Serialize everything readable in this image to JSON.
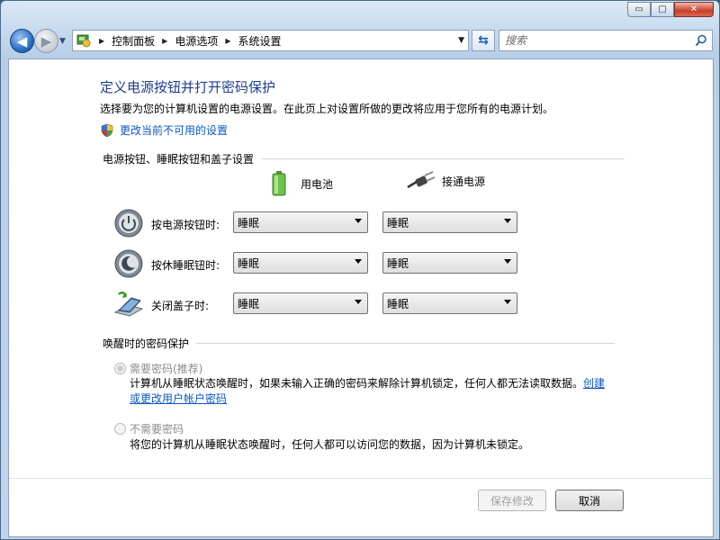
{
  "window": {
    "buttons": {
      "minimize": "▭",
      "maximize": "□",
      "close": "✕"
    }
  },
  "nav": {
    "breadcrumbs": [
      "控制面板",
      "电源选项",
      "系统设置"
    ],
    "search_placeholder": "搜索"
  },
  "page": {
    "title": "定义电源按钮并打开密码保护",
    "description": "选择要为您的计算机设置的电源设置。在此页上对设置所做的更改将应用于您所有的电源计划。",
    "change_link": "更改当前不可用的设置"
  },
  "buttons_section": {
    "heading": "电源按钮、睡眠按钮和盖子设置",
    "col_battery": "用电池",
    "col_plugged": "接通电源",
    "rows": [
      {
        "label": "按电源按钮时:",
        "battery": "睡眠",
        "plugged": "睡眠",
        "icon": "power-button-icon"
      },
      {
        "label": "按休睡眠钮时:",
        "battery": "睡眠",
        "plugged": "睡眠",
        "icon": "sleep-button-icon"
      },
      {
        "label": "关闭盖子时:",
        "battery": "睡眠",
        "plugged": "睡眠",
        "icon": "laptop-lid-icon"
      }
    ]
  },
  "password_section": {
    "heading": "唤醒时的密码保护",
    "require_label": "需要密码(推荐)",
    "require_desc": "计算机从睡眠状态唤醒时，如果未输入正确的密码来解除计算机锁定，任何人都无法读取数据。",
    "require_link": "创建或更改用户帐户密码",
    "no_require_label": "不需要密码",
    "no_require_desc": "将您的计算机从睡眠状态唤醒时，任何人都可以访问您的数据，因为计算机未锁定。"
  },
  "footer": {
    "save": "保存修改",
    "cancel": "取消"
  }
}
